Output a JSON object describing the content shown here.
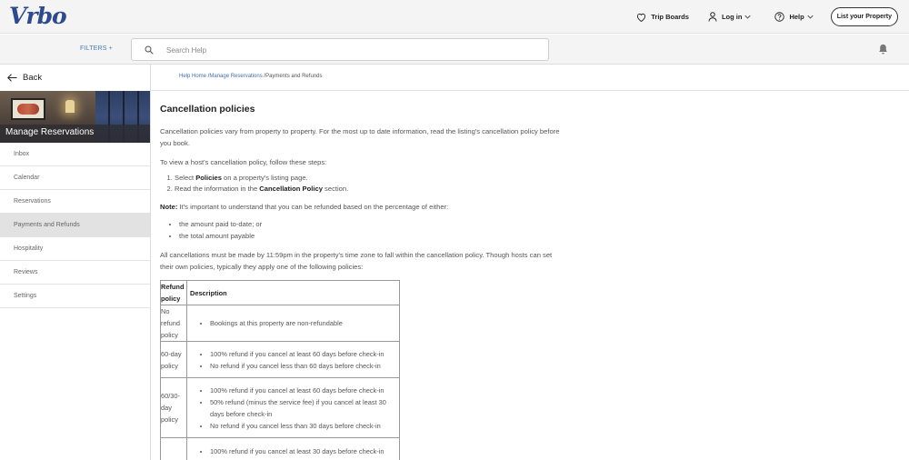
{
  "header": {
    "logo": "Vrbo",
    "trip_boards": "Trip Boards",
    "login": "Log in",
    "help": "Help",
    "list_property": "List your Property"
  },
  "searchbar": {
    "filters": "FILTERS +",
    "placeholder": "Search Help"
  },
  "sidebar": {
    "back": "Back",
    "section_title": "Manage Reservations",
    "items": [
      {
        "label": "Inbox"
      },
      {
        "label": "Calendar"
      },
      {
        "label": "Reservations"
      },
      {
        "label": "Payments and Refunds"
      },
      {
        "label": "Hospitality"
      },
      {
        "label": "Reviews"
      },
      {
        "label": "Settings"
      }
    ],
    "active_index": 3
  },
  "breadcrumb": {
    "home": "Help Home",
    "sep1": " /",
    "section": "Manage Reservations",
    "sep2": " /",
    "current": "Payments and Refunds"
  },
  "article": {
    "title": "Cancellation policies",
    "intro": "Cancellation policies vary from property to property. For the most up to date information, read the listing's cancellation policy before you book.",
    "steps_intro": "To view a host's cancellation policy, follow these steps:",
    "step1_pre": "Select ",
    "step1_bold": "Policies",
    "step1_post": " on a property's listing page.",
    "step2_pre": "Read the information in the ",
    "step2_bold": "Cancellation Policy",
    "step2_post": " section.",
    "note_label": "Note:",
    "note_text": " It's important to understand that you can be refunded based on the percentage of either:",
    "note_bullets": [
      "the amount paid to-date; or",
      "the total amount payable"
    ],
    "cutoff": "All cancellations must be made by 11:59pm in the property's time zone to fall within the cancellation policy. Though hosts can set their own policies, typically they apply one of the following policies:",
    "table": {
      "col1": "Refund policy",
      "col2": "Description",
      "rows": [
        {
          "policy": "No refund policy",
          "bullets": [
            "Bookings at this property are non-refundable"
          ]
        },
        {
          "policy": "60-day policy",
          "bullets": [
            "100% refund if you cancel at least 60 days before check-in",
            "No refund if you cancel less than 60 days before check-in"
          ]
        },
        {
          "policy": "60/30-day policy",
          "bullets": [
            "100% refund if you cancel at least 60 days before check-in",
            "50% refund (minus the service fee) if you cancel at least 30 days before check-in",
            "No refund if you cancel less than 30 days before check-in"
          ]
        },
        {
          "policy": "",
          "bullets": [
            "100% refund if you cancel at least 30 days before check-in"
          ]
        }
      ]
    }
  }
}
